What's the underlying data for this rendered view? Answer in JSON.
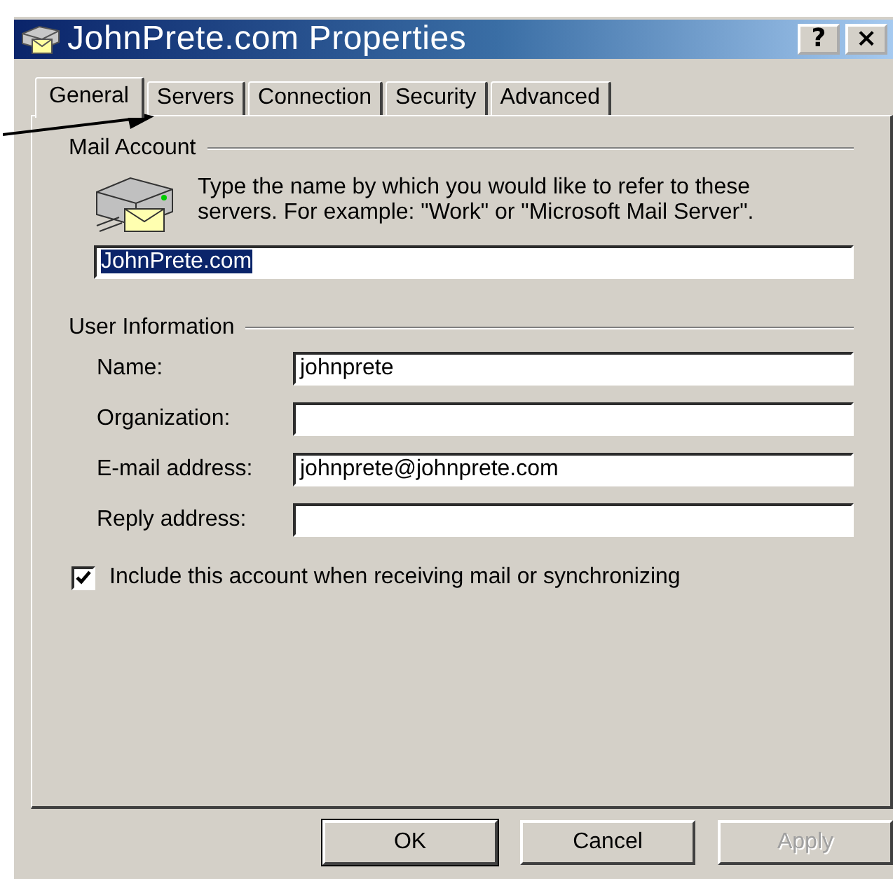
{
  "window": {
    "title": "JohnPrete.com Properties",
    "title_buttons": [
      "?",
      "×"
    ]
  },
  "tabs": [
    {
      "label": "General",
      "selected": true
    },
    {
      "label": "Servers",
      "selected": false
    },
    {
      "label": "Connection",
      "selected": false
    },
    {
      "label": "Security",
      "selected": false
    },
    {
      "label": "Advanced",
      "selected": false
    }
  ],
  "mail_account": {
    "label": "Mail Account",
    "description": "Type the name by which you would like to refer to these servers.  For example: \"Work\" or \"Microsoft Mail Server\".",
    "value": "JohnPrete.com",
    "text_selected": true
  },
  "user_information": {
    "label": "User Information",
    "fields": [
      {
        "label": "Name:",
        "value": "johnprete"
      },
      {
        "label": "Organization:"
      },
      {
        "label": "E-mail address:",
        "value": "johnprete@johnprete.com"
      },
      {
        "label": "Reply address:"
      }
    ]
  },
  "include_account": {
    "label": "Include this account when receiving mail or synchronizing",
    "checked": true
  },
  "buttons": [
    {
      "label": "OK",
      "default": true,
      "disabled": false
    },
    {
      "label": "Cancel",
      "default": false,
      "disabled": false
    },
    {
      "label": "Apply",
      "default": false,
      "disabled": true
    }
  ]
}
